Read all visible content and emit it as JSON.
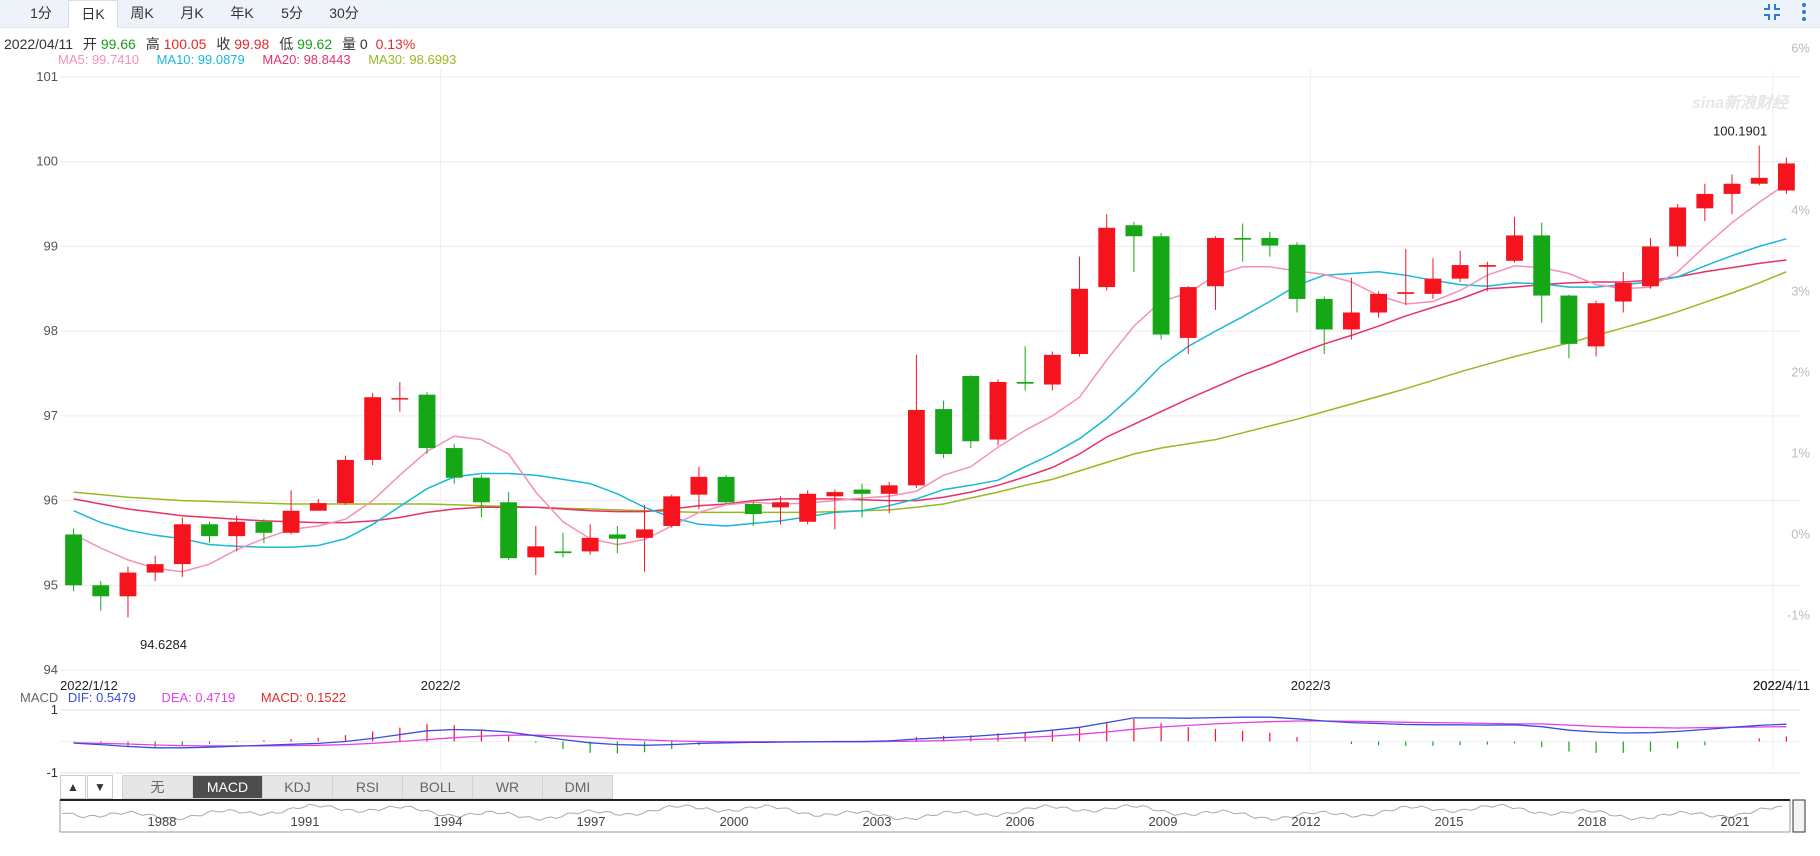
{
  "tabs": [
    {
      "label": "1分",
      "active": false
    },
    {
      "label": "日K",
      "active": true
    },
    {
      "label": "周K",
      "active": false
    },
    {
      "label": "月K",
      "active": false
    },
    {
      "label": "年K",
      "active": false
    },
    {
      "label": "5分",
      "active": false
    },
    {
      "label": "30分",
      "active": false
    }
  ],
  "icons": {
    "collapse": "collapse-arrows-icon",
    "more": "more-vertical-icon"
  },
  "quote": {
    "date": "2022/04/11",
    "open_label": "开",
    "open": "99.66",
    "high_label": "高",
    "high": "100.05",
    "close_label": "收",
    "close": "99.98",
    "low_label": "低",
    "low": "99.62",
    "vol_label": "量",
    "vol": "0",
    "change": "0.13%"
  },
  "ma": {
    "ma5": "MA5: 99.7410",
    "ma10": "MA10: 99.0879",
    "ma20": "MA20: 98.8443",
    "ma30": "MA30: 98.6993"
  },
  "macd_info": {
    "label": "MACD",
    "dif": "DIF: 0.5479",
    "dea": "DEA: 0.4719",
    "macd": "MACD: 0.1522"
  },
  "indicator_tabs": [
    "无",
    "MACD",
    "KDJ",
    "RSI",
    "BOLL",
    "WR",
    "DMI"
  ],
  "indicator_active": "MACD",
  "arrows": [
    "▲",
    "▼"
  ],
  "watermark": "sina新浪财经",
  "colors": {
    "up": "#f5141e",
    "down": "#15a715",
    "ma5": "#f590b8",
    "ma10": "#18b8d8",
    "ma20": "#e8306a",
    "ma30": "#9ab820",
    "dif": "#3a4be0",
    "dea": "#e040e8"
  },
  "chart_data": [
    {
      "type": "candlestick",
      "y_ticks": [
        "94",
        "95",
        "96",
        "97",
        "98",
        "99",
        "100",
        "101"
      ],
      "pct_ticks": [
        "6%",
        "4%",
        "3%",
        "2%",
        "1%",
        "0%",
        "-1%"
      ],
      "x_labels": [
        "2022/1/12",
        "2022/2",
        "2022/3",
        "2022/4",
        "2022/4/11"
      ],
      "ylim": [
        94,
        101
      ],
      "min_label": "94.6284",
      "max_label": "100.1901",
      "candles": [
        [
          95.6,
          95.0,
          95.67,
          94.93
        ],
        [
          95.0,
          94.87,
          95.05,
          94.7
        ],
        [
          94.87,
          95.15,
          95.22,
          94.62
        ],
        [
          95.15,
          95.25,
          95.35,
          95.05
        ],
        [
          95.25,
          95.72,
          95.8,
          95.1
        ],
        [
          95.72,
          95.58,
          95.75,
          95.5
        ],
        [
          95.58,
          95.75,
          95.82,
          95.4
        ],
        [
          95.75,
          95.62,
          95.78,
          95.5
        ],
        [
          95.62,
          95.88,
          96.12,
          95.6
        ],
        [
          95.88,
          95.97,
          96.02,
          95.88
        ],
        [
          95.97,
          96.48,
          96.53,
          95.95
        ],
        [
          96.48,
          97.22,
          97.27,
          96.42
        ],
        [
          97.2,
          97.21,
          97.4,
          97.05
        ],
        [
          97.25,
          96.62,
          97.28,
          96.55
        ],
        [
          96.62,
          96.27,
          96.67,
          96.2
        ],
        [
          96.27,
          95.98,
          96.3,
          95.8
        ],
        [
          95.98,
          95.32,
          96.1,
          95.3
        ],
        [
          95.33,
          95.46,
          95.7,
          95.12
        ],
        [
          95.4,
          95.38,
          95.62,
          95.33
        ],
        [
          95.4,
          95.56,
          95.72,
          95.36
        ],
        [
          95.6,
          95.55,
          95.7,
          95.38
        ],
        [
          95.56,
          95.66,
          95.95,
          95.16
        ],
        [
          95.7,
          96.05,
          96.07,
          95.68
        ],
        [
          96.07,
          96.28,
          96.4,
          95.9
        ],
        [
          96.28,
          95.98,
          96.3,
          95.96
        ],
        [
          95.96,
          95.84,
          95.98,
          95.7
        ],
        [
          95.92,
          95.98,
          96.05,
          95.72
        ],
        [
          95.75,
          96.08,
          96.12,
          95.72
        ],
        [
          96.05,
          96.1,
          96.13,
          95.66
        ],
        [
          96.13,
          96.08,
          96.2,
          95.8
        ],
        [
          96.08,
          96.18,
          96.22,
          95.85
        ],
        [
          96.18,
          97.07,
          97.72,
          96.15
        ],
        [
          97.08,
          96.55,
          97.18,
          96.5
        ],
        [
          97.47,
          96.7,
          97.48,
          96.62
        ],
        [
          96.72,
          97.4,
          97.43,
          96.65
        ],
        [
          97.4,
          97.38,
          97.82,
          97.3
        ],
        [
          97.37,
          97.72,
          97.76,
          97.3
        ],
        [
          97.73,
          98.5,
          98.88,
          97.7
        ],
        [
          98.52,
          99.22,
          99.38,
          98.48
        ],
        [
          99.25,
          99.12,
          99.29,
          98.7
        ],
        [
          99.12,
          97.96,
          99.16,
          97.9
        ],
        [
          97.92,
          98.52,
          98.53,
          97.73
        ],
        [
          98.53,
          99.1,
          99.12,
          98.25
        ],
        [
          99.1,
          99.08,
          99.27,
          98.82
        ],
        [
          99.1,
          99.01,
          99.17,
          98.88
        ],
        [
          99.02,
          98.38,
          99.05,
          98.22
        ],
        [
          98.38,
          98.02,
          98.41,
          97.73
        ],
        [
          98.02,
          98.22,
          98.63,
          97.9
        ],
        [
          98.22,
          98.44,
          98.47,
          98.16
        ],
        [
          98.44,
          98.46,
          98.97,
          98.31
        ],
        [
          98.44,
          98.62,
          98.86,
          98.38
        ],
        [
          98.62,
          98.78,
          98.95,
          98.58
        ],
        [
          98.76,
          98.78,
          98.82,
          98.47
        ],
        [
          98.83,
          99.13,
          99.35,
          98.81
        ],
        [
          99.13,
          98.42,
          99.28,
          98.1
        ],
        [
          98.42,
          97.85,
          98.43,
          97.68
        ],
        [
          97.82,
          98.33,
          98.36,
          97.7
        ],
        [
          98.35,
          98.57,
          98.7,
          98.22
        ],
        [
          98.53,
          99.0,
          99.1,
          98.5
        ],
        [
          99.0,
          99.46,
          99.5,
          98.88
        ],
        [
          99.45,
          99.62,
          99.74,
          99.3
        ],
        [
          99.62,
          99.74,
          99.85,
          99.38
        ],
        [
          99.74,
          99.81,
          100.19,
          99.72
        ],
        [
          99.66,
          99.98,
          100.05,
          99.62
        ]
      ],
      "ma5": [
        95.6,
        95.44,
        95.3,
        95.2,
        95.16,
        95.25,
        95.42,
        95.55,
        95.66,
        95.7,
        95.78,
        96.0,
        96.3,
        96.58,
        96.76,
        96.72,
        96.55,
        96.1,
        95.75,
        95.55,
        95.48,
        95.54,
        95.7,
        95.86,
        95.95,
        95.98,
        95.96,
        95.97,
        96.0,
        96.03,
        96.05,
        96.11,
        96.3,
        96.4,
        96.63,
        96.83,
        97.0,
        97.22,
        97.66,
        98.06,
        98.35,
        98.45,
        98.66,
        98.76,
        98.76,
        98.71,
        98.67,
        98.58,
        98.42,
        98.32,
        98.35,
        98.48,
        98.66,
        98.77,
        98.75,
        98.68,
        98.55,
        98.5,
        98.52,
        98.7,
        99.0,
        99.28,
        99.52,
        99.74
      ],
      "ma10": [
        95.88,
        95.74,
        95.65,
        95.59,
        95.55,
        95.48,
        95.46,
        95.45,
        95.45,
        95.47,
        95.55,
        95.72,
        95.93,
        96.14,
        96.28,
        96.32,
        96.32,
        96.3,
        96.25,
        96.2,
        96.08,
        95.92,
        95.8,
        95.72,
        95.7,
        95.73,
        95.76,
        95.81,
        95.86,
        95.88,
        95.94,
        96.02,
        96.13,
        96.18,
        96.24,
        96.4,
        96.55,
        96.73,
        96.97,
        97.26,
        97.59,
        97.82,
        98.0,
        98.17,
        98.35,
        98.54,
        98.66,
        98.68,
        98.7,
        98.66,
        98.6,
        98.55,
        98.53,
        98.57,
        98.56,
        98.52,
        98.52,
        98.55,
        98.58,
        98.64,
        98.77,
        98.89,
        99.0,
        99.09
      ],
      "ma20": [
        96.02,
        95.96,
        95.9,
        95.86,
        95.82,
        95.8,
        95.78,
        95.76,
        95.75,
        95.74,
        95.74,
        95.76,
        95.8,
        95.86,
        95.9,
        95.92,
        95.92,
        95.92,
        95.9,
        95.88,
        95.87,
        95.87,
        95.9,
        95.94,
        95.96,
        96.0,
        96.02,
        96.02,
        96.02,
        96.01,
        96.0,
        96.0,
        96.04,
        96.1,
        96.18,
        96.28,
        96.39,
        96.55,
        96.75,
        96.9,
        97.05,
        97.2,
        97.34,
        97.48,
        97.6,
        97.73,
        97.85,
        97.95,
        98.06,
        98.18,
        98.28,
        98.38,
        98.5,
        98.52,
        98.55,
        98.57,
        98.58,
        98.58,
        98.6,
        98.64,
        98.7,
        98.75,
        98.8,
        98.84
      ],
      "ma30": [
        96.1,
        96.07,
        96.04,
        96.02,
        96.0,
        95.99,
        95.98,
        95.97,
        95.96,
        95.96,
        95.96,
        95.96,
        95.96,
        95.96,
        95.95,
        95.94,
        95.93,
        95.92,
        95.91,
        95.9,
        95.89,
        95.88,
        95.87,
        95.86,
        95.86,
        95.86,
        95.86,
        95.86,
        95.87,
        95.88,
        95.89,
        95.92,
        95.96,
        96.03,
        96.1,
        96.18,
        96.25,
        96.35,
        96.45,
        96.55,
        96.62,
        96.67,
        96.72,
        96.8,
        96.88,
        96.96,
        97.05,
        97.14,
        97.23,
        97.32,
        97.42,
        97.52,
        97.61,
        97.7,
        97.78,
        97.86,
        97.95,
        98.04,
        98.13,
        98.23,
        98.34,
        98.45,
        98.57,
        98.7
      ]
    },
    {
      "type": "macd",
      "ylim": [
        -1,
        1
      ],
      "y_ticks": [
        "1",
        "-1"
      ],
      "dif": [
        -0.05,
        -0.1,
        -0.16,
        -0.2,
        -0.2,
        -0.18,
        -0.15,
        -0.12,
        -0.09,
        -0.06,
        0.0,
        0.1,
        0.22,
        0.34,
        0.38,
        0.36,
        0.3,
        0.18,
        0.06,
        -0.04,
        -0.1,
        -0.12,
        -0.1,
        -0.06,
        -0.04,
        -0.03,
        -0.02,
        -0.01,
        0.0,
        0.0,
        0.02,
        0.08,
        0.12,
        0.16,
        0.22,
        0.28,
        0.36,
        0.45,
        0.6,
        0.75,
        0.75,
        0.74,
        0.76,
        0.77,
        0.77,
        0.72,
        0.65,
        0.6,
        0.57,
        0.54,
        0.53,
        0.53,
        0.52,
        0.53,
        0.47,
        0.36,
        0.3,
        0.27,
        0.28,
        0.32,
        0.38,
        0.45,
        0.51,
        0.55
      ],
      "dea": [
        -0.04,
        -0.06,
        -0.08,
        -0.11,
        -0.13,
        -0.14,
        -0.14,
        -0.14,
        -0.13,
        -0.12,
        -0.1,
        -0.06,
        0.0,
        0.06,
        0.12,
        0.17,
        0.2,
        0.2,
        0.18,
        0.14,
        0.09,
        0.05,
        0.02,
        0.0,
        -0.01,
        -0.01,
        -0.01,
        -0.01,
        -0.01,
        -0.01,
        0.0,
        0.01,
        0.03,
        0.06,
        0.09,
        0.13,
        0.17,
        0.23,
        0.3,
        0.39,
        0.46,
        0.51,
        0.56,
        0.6,
        0.63,
        0.65,
        0.65,
        0.64,
        0.63,
        0.61,
        0.6,
        0.59,
        0.57,
        0.56,
        0.56,
        0.52,
        0.48,
        0.45,
        0.44,
        0.43,
        0.44,
        0.45,
        0.46,
        0.47
      ]
    }
  ],
  "navigator_years": [
    "1988",
    "1991",
    "1994",
    "1997",
    "2000",
    "2003",
    "2006",
    "2009",
    "2012",
    "2015",
    "2018",
    "2021"
  ]
}
